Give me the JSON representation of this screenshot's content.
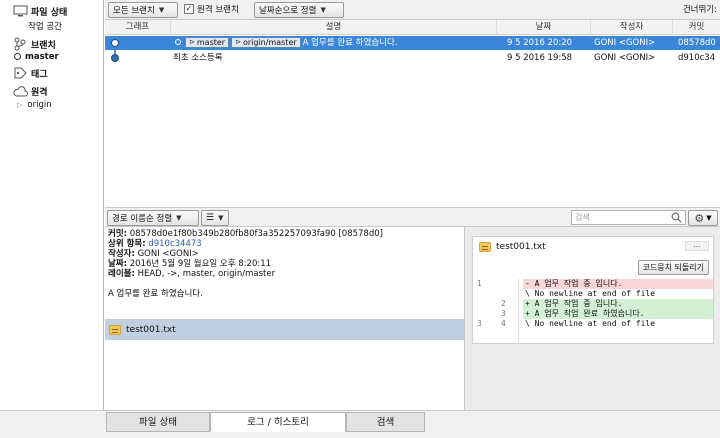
{
  "sidebar": {
    "file_status": {
      "label": "파일 상태",
      "sub": "작업 공간"
    },
    "branches": {
      "label": "브랜치",
      "sub": "master"
    },
    "tags": {
      "label": "태그"
    },
    "remotes": {
      "label": "원격",
      "sub": "origin"
    }
  },
  "toolbar": {
    "branch_filter": "모든 브랜치",
    "remote_branches_label": "원격 브랜치",
    "remote_branches_checked": true,
    "sort_order": "날짜순으로 정렬",
    "skip_label": "건너뛰기:"
  },
  "commit_table": {
    "headers": {
      "graph": "그래프",
      "description": "설명",
      "date": "날짜",
      "author": "작성자",
      "commit": "커밋"
    },
    "rows": [
      {
        "tags": [
          "master",
          "origin/master"
        ],
        "description": "A 업무를 완료 하였습니다.",
        "date": "9 5 2016 20:20",
        "author": "GONI <GONI>",
        "commit": "08578d0",
        "selected": true
      },
      {
        "tags": [],
        "description": "최초 소스등록",
        "date": "9 5 2016 19:58",
        "author": "GONI <GONI>",
        "commit": "d910c34",
        "selected": false
      }
    ]
  },
  "lower_toolbar": {
    "path_sort": "경로 이름순 정렬",
    "search_placeholder": "검색"
  },
  "details": {
    "commit_label": "커밋:",
    "commit_value": "08578d0e1f80b349b280fb80f3a352257093fa90 [08578d0]",
    "parent_label": "상위 항목:",
    "parent_value": "d910c34473",
    "author_label": "작성자:",
    "author_value": "GONI <GONI>",
    "date_label": "날짜:",
    "date_value": "2016년 5월 9일 월요일 오후 8:20:11",
    "labels_label": "레이블:",
    "labels_value": "HEAD, ->, master, origin/master",
    "message": "A 업무를 완료 하였습니다."
  },
  "files": [
    {
      "name": "test001.txt"
    }
  ],
  "diff": {
    "file_name": "test001.txt",
    "more_label": "...",
    "revert_label": "코드뭉치 되돌리기",
    "lines": [
      {
        "old": "1",
        "new": "",
        "type": "rem",
        "text": "- A 업무 작업 중 입니다."
      },
      {
        "old": "",
        "new": "",
        "type": "ctx",
        "text": "\\  No newline at end of file"
      },
      {
        "old": "",
        "new": "2",
        "type": "add",
        "text": "+ A 업무 작업 중 입니다."
      },
      {
        "old": "",
        "new": "3",
        "type": "add",
        "text": "+ A 업무 작업 완료 하였습니다."
      },
      {
        "old": "3",
        "new": "4",
        "type": "ctx",
        "text": "\\  No newline at end of file"
      }
    ]
  },
  "bottom_tabs": [
    "파일 상태",
    "로그 / 히스토리",
    "검색"
  ],
  "colors": {
    "selection": "#3b86d8",
    "removed": "#f8d6d6",
    "added": "#d4f0d4",
    "graph_line": "#2f6fa8"
  }
}
